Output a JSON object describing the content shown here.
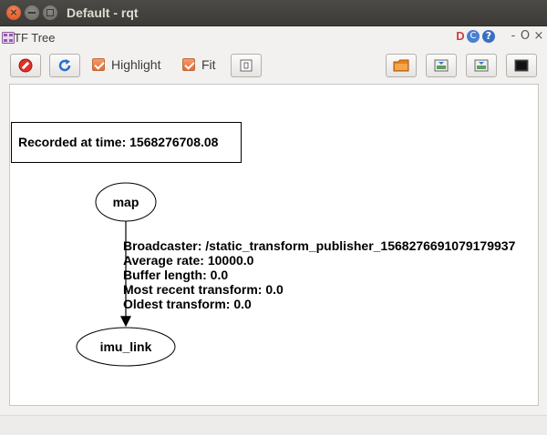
{
  "window": {
    "title": "Default - rqt",
    "close_glyph": "×"
  },
  "plugin": {
    "title": "TF Tree",
    "header_icons": {
      "d": "D",
      "c": "C",
      "help": "?",
      "dash": "-",
      "o": "O",
      "x": "×"
    }
  },
  "toolbar": {
    "highlight_label": "Highlight",
    "highlight_checked": true,
    "fit_label": "Fit",
    "fit_checked": true
  },
  "graph": {
    "recorded": "Recorded at time: 1568276708.08",
    "nodes": {
      "map": "map",
      "imu_link": "imu_link"
    },
    "edge_label": [
      "Broadcaster: /static_transform_publisher_1568276691079179937",
      "Average rate: 10000.0",
      "Buffer length: 0.0",
      "Most recent transform: 0.0",
      "Oldest transform: 0.0"
    ]
  },
  "colors": {
    "titlebar": "#3c3b37",
    "close_button": "#df4b16",
    "checkbox": "#e26d34",
    "canvas": "#ffffff"
  }
}
